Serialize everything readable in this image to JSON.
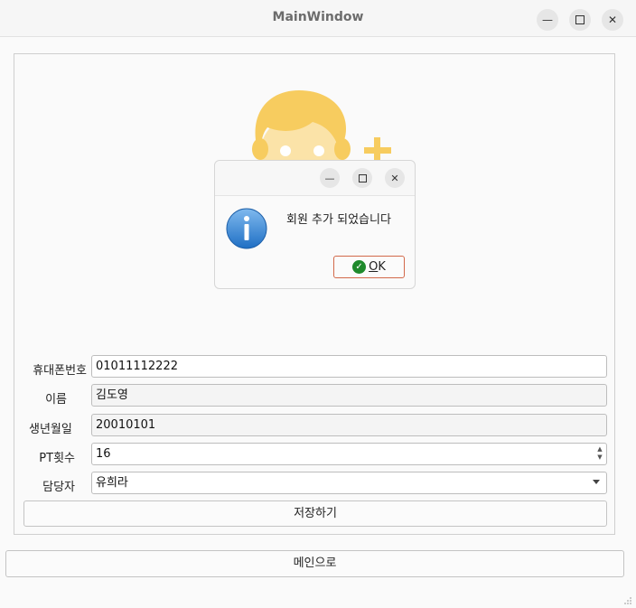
{
  "window": {
    "title": "MainWindow"
  },
  "form": {
    "phone_label": "휴대폰번호",
    "phone_value": "01011112222",
    "name_label": "이름",
    "name_value": "김도영",
    "birth_label": "생년월일",
    "birth_value": "20010101",
    "pt_label": "PT횟수",
    "pt_value": "16",
    "trainer_label": "담당자",
    "trainer_value": "유희라",
    "save_button": "저장하기"
  },
  "main_button": "메인으로",
  "dialog": {
    "message": "회원 추가 되었습니다",
    "ok_label": "OK",
    "ok_mnemonic": "O",
    "ok_rest": "K"
  },
  "colors": {
    "avatar_hair": "#f7cc5f",
    "avatar_face": "#fbe3a8",
    "info_blue": "#2a7fd6",
    "ok_border": "#d2694a",
    "ok_check": "#1f8a2c"
  }
}
